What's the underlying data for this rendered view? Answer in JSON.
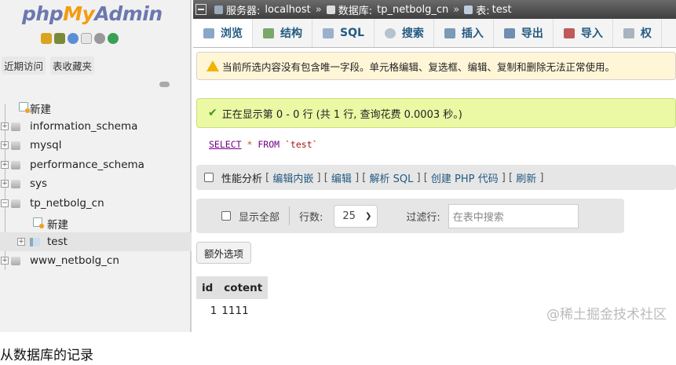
{
  "app": {
    "logo_php": "php",
    "logo_my": "My",
    "logo_admin": "Admin"
  },
  "left_tabs": [
    "近期访问",
    "表收藏夹"
  ],
  "tree": {
    "new_label": "新建",
    "databases": [
      "information_schema",
      "mysql",
      "performance_schema",
      "sys",
      "tp_netbolg_cn",
      "www_netbolg_cn"
    ],
    "child_new_label": "新建",
    "child_table": "test"
  },
  "breadcrumb": {
    "server_label": "服务器:",
    "server": "localhost",
    "db_label": "数据库:",
    "db": "tp_netbolg_cn",
    "table_label": "表:",
    "table": "test",
    "sep": "»"
  },
  "tabs": [
    "浏览",
    "结构",
    "SQL",
    "搜索",
    "插入",
    "导出",
    "导入",
    "权"
  ],
  "warning": "当前所选内容没有包含唯一字段。单元格编辑、复选框、编辑、复制和删除无法正常使用。",
  "success": "正在显示第 0 - 0 行 (共 1 行, 查询花费 0.0003 秒。)",
  "sql": {
    "select": "SELECT",
    "star": "*",
    "from": "FROM",
    "table": "`test`"
  },
  "profiling": {
    "label": "性能分析",
    "links": [
      "编辑内嵌",
      "编辑",
      "解析 SQL",
      "创建 PHP 代码",
      "刷新"
    ]
  },
  "navigation": {
    "show_all": "显示全部",
    "rows_label": "行数:",
    "rows_value": "25",
    "filter_label": "过滤行:",
    "filter_placeholder": "在表中搜索"
  },
  "extra_options": "额外选项",
  "results": {
    "columns": [
      "id",
      "cotent"
    ],
    "rows": [
      [
        "1",
        "1111"
      ]
    ]
  },
  "watermark": "@稀土掘金技术社区",
  "caption": "从数据库的记录",
  "colors": {
    "brand_blue": "#6c78af",
    "brand_orange": "#f39c12",
    "link": "#235a81",
    "success_bg": "#ebf8a4",
    "warning_bg": "#fff6d8"
  }
}
